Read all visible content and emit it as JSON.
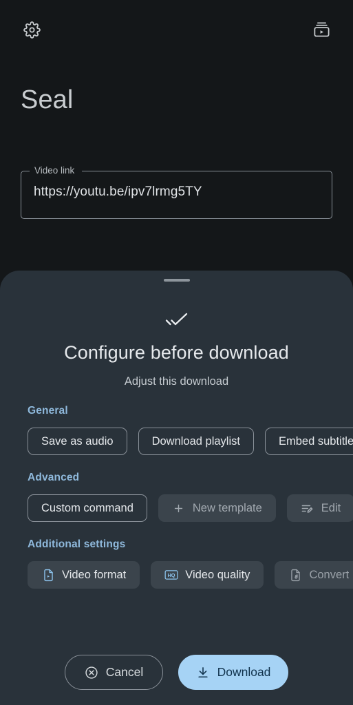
{
  "app": {
    "title": "Seal",
    "background_color": "#141719",
    "accent_blue": "#8fb9dc"
  },
  "topbar": {
    "settings_icon": "gear-icon",
    "settings_label": "Settings",
    "library_icon": "video-library-icon",
    "library_label": "Downloads"
  },
  "video_link_field": {
    "label": "Video link",
    "value": "https://youtu.be/ipv7lrmg5TY",
    "placeholder": "Video link"
  },
  "sheet": {
    "handle": "drag-handle",
    "hero_icon": "done-all-icon",
    "title": "Configure before download",
    "subtitle": "Adjust this download",
    "background_color": "#29323a",
    "sections": [
      {
        "title": "General",
        "chips": [
          {
            "label": "Save as audio",
            "style": "outlined",
            "icon": null,
            "enabled": true
          },
          {
            "label": "Download playlist",
            "style": "outlined",
            "icon": null,
            "enabled": true
          },
          {
            "label": "Embed subtitles",
            "style": "outlined",
            "icon": null,
            "enabled": true
          }
        ]
      },
      {
        "title": "Advanced",
        "chips": [
          {
            "label": "Custom command",
            "style": "outlined",
            "icon": null,
            "enabled": true
          },
          {
            "label": "New template",
            "style": "filled",
            "icon": "plus-icon",
            "enabled": false
          },
          {
            "label": "Edit",
            "style": "filled",
            "icon": "edit-note-icon",
            "enabled": false
          }
        ]
      },
      {
        "title": "Additional settings",
        "chips": [
          {
            "label": "Video format",
            "style": "filled",
            "icon": "video-file-icon",
            "enabled": true
          },
          {
            "label": "Video quality",
            "style": "filled",
            "icon": "hq-icon",
            "enabled": true
          },
          {
            "label": "Convert",
            "style": "filled",
            "icon": "audio-file-icon",
            "enabled": false
          }
        ]
      }
    ]
  },
  "actions": {
    "cancel_label": "Cancel",
    "cancel_icon": "cancel-circle-icon",
    "download_label": "Download",
    "download_icon": "download-icon",
    "download_color": "#a6d3f5"
  }
}
